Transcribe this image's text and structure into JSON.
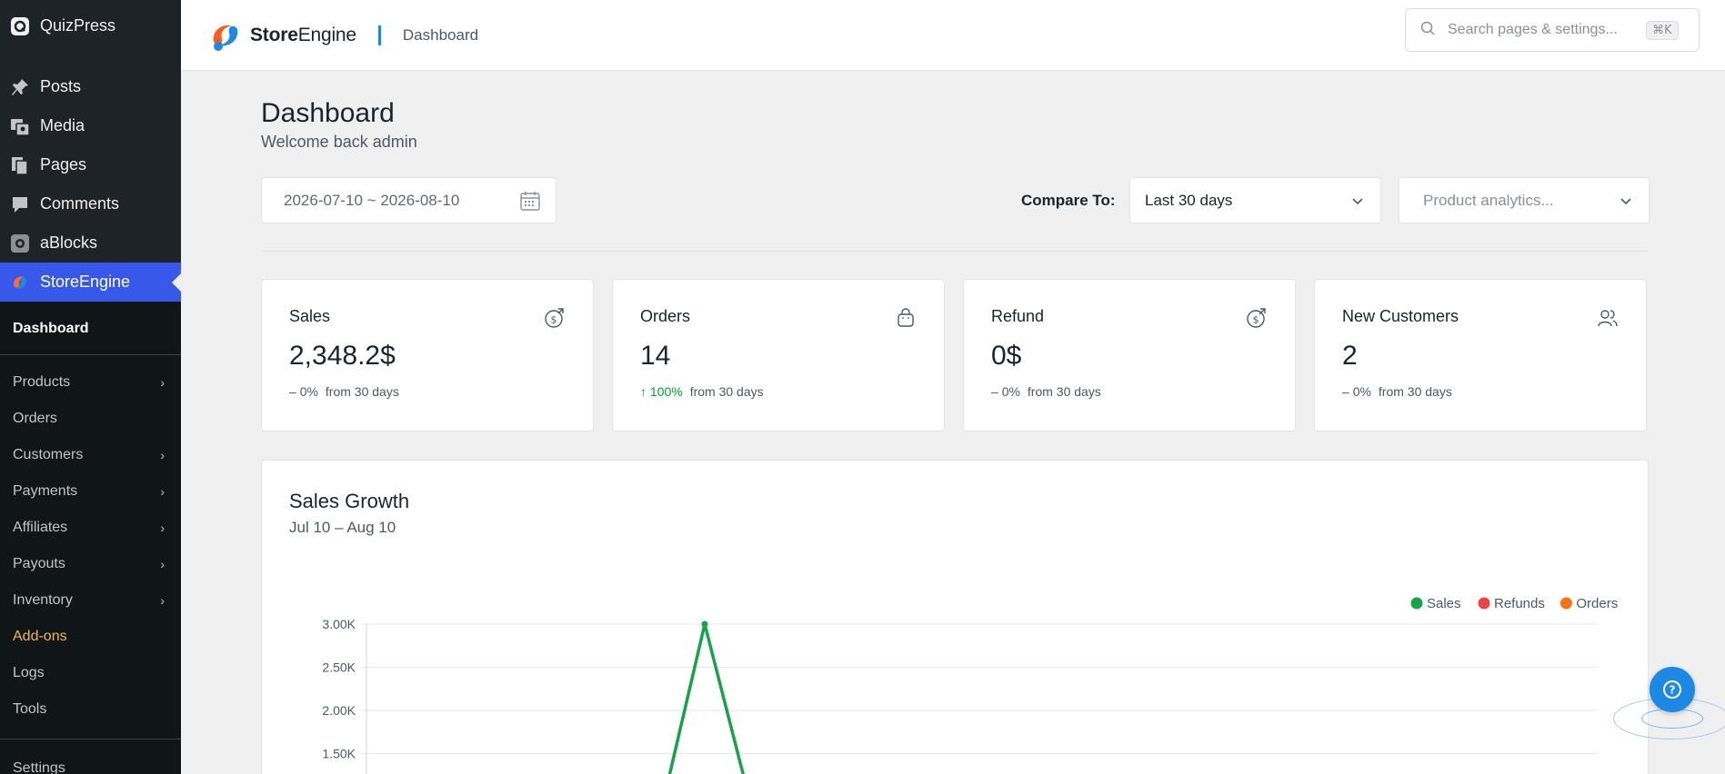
{
  "wp_menu": {
    "quizpress": "QuizPress",
    "posts": "Posts",
    "media": "Media",
    "pages": "Pages",
    "comments": "Comments",
    "ablocks": "aBlocks",
    "storeengine": "StoreEngine"
  },
  "submenu": {
    "dashboard": "Dashboard",
    "items": [
      {
        "label": "Products",
        "has_children": true
      },
      {
        "label": "Orders",
        "has_children": false
      },
      {
        "label": "Customers",
        "has_children": true
      },
      {
        "label": "Payments",
        "has_children": true
      },
      {
        "label": "Affiliates",
        "has_children": true
      },
      {
        "label": "Payouts",
        "has_children": true
      },
      {
        "label": "Inventory",
        "has_children": true
      },
      {
        "label": "Add-ons",
        "has_children": false
      },
      {
        "label": "Logs",
        "has_children": false
      },
      {
        "label": "Tools",
        "has_children": false
      }
    ],
    "settings": "Settings",
    "chevron": "›"
  },
  "header": {
    "brand_bold": "Store",
    "brand_rest": "Engine",
    "breadcrumb": "Dashboard",
    "search_placeholder": "Search pages & settings...",
    "shortcut": "⌘K"
  },
  "page": {
    "title": "Dashboard",
    "subtitle": "Welcome back admin"
  },
  "filters": {
    "date_range": "2026-07-10 ~ 2026-08-10",
    "compare_label": "Compare To:",
    "compare_value": "Last 30 days",
    "product_placeholder": "Product analytics..."
  },
  "cards": [
    {
      "title": "Sales",
      "value": "2,348.2$",
      "delta_sign": "–",
      "delta": "0%",
      "period": "from 30 days",
      "icon": "dollar-in-icon",
      "trend": "flat"
    },
    {
      "title": "Orders",
      "value": "14",
      "delta_sign": "↑",
      "delta": "100%",
      "period": "from 30 days",
      "icon": "shopping-bag-icon",
      "trend": "up"
    },
    {
      "title": "Refund",
      "value": "0$",
      "delta_sign": "–",
      "delta": "0%",
      "period": "from 30 days",
      "icon": "dollar-out-icon",
      "trend": "flat"
    },
    {
      "title": "New Customers",
      "value": "2",
      "delta_sign": "–",
      "delta": "0%",
      "period": "from 30 days",
      "icon": "users-icon",
      "trend": "flat"
    }
  ],
  "growth": {
    "title": "Sales Growth",
    "subtitle": "Jul 10 – Aug 10"
  },
  "chart_data": {
    "type": "line",
    "yticks": [
      "3.00K",
      "2.50K",
      "2.00K",
      "1.50K"
    ],
    "ylim_visible": [
      1500,
      3000
    ],
    "legend": [
      "Sales",
      "Refunds",
      "Orders"
    ],
    "legend_position": "top-right",
    "grid": true,
    "series": [
      {
        "name": "Sales",
        "color": "#16a34a",
        "peak_value": 3000
      },
      {
        "name": "Refunds",
        "color": "#ef4444"
      },
      {
        "name": "Orders",
        "color": "#f97316"
      }
    ]
  },
  "colors": {
    "accent": "#3858e9",
    "brand_blue": "#1e88e5",
    "addon": "#f0b849",
    "positive": "#00a32a"
  }
}
